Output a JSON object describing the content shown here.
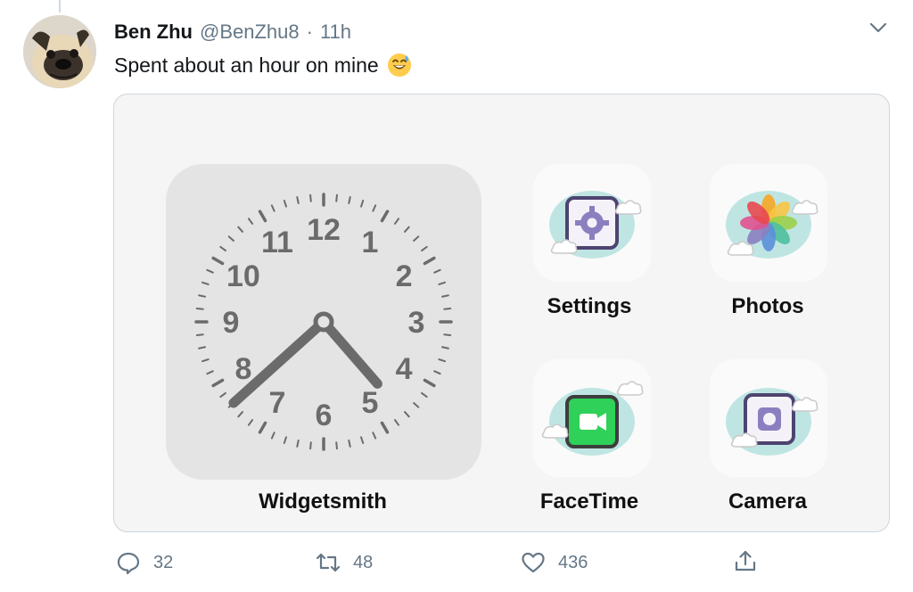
{
  "tweet": {
    "author_name": "Ben Zhu",
    "author_handle": "@BenZhu8",
    "separator": "·",
    "time": "11h",
    "text": "Spent about an hour on mine",
    "text_emoji": "grinning-sweat-emoji",
    "avatar": "pug-avatar",
    "menu_icon": "chevron-down-icon"
  },
  "media": {
    "clock_numbers": [
      "12",
      "1",
      "2",
      "3",
      "4",
      "5",
      "6",
      "7",
      "8",
      "9",
      "10",
      "11"
    ],
    "clock_time": "4:38",
    "apps": {
      "widget_label": "Widgetsmith",
      "settings_label": "Settings",
      "photos_label": "Photos",
      "facetime_label": "FaceTime",
      "camera_label": "Camera"
    },
    "colors": {
      "card_bg": "#f5f5f5",
      "widget_bg": "#e4e4e4",
      "clock_ink": "#6b6b6b",
      "cloud_teal": "#bfe5e3",
      "icon_purple": "#6b5b95",
      "facetime_green": "#2fd158"
    }
  },
  "actions": {
    "reply_count": "32",
    "retweet_count": "48",
    "like_count": "436",
    "reply_icon": "reply-icon",
    "retweet_icon": "retweet-icon",
    "like_icon": "heart-icon",
    "share_icon": "share-icon"
  }
}
